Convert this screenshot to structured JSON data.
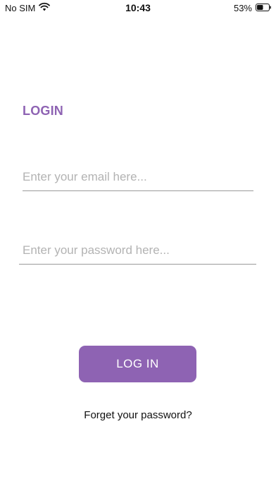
{
  "status_bar": {
    "carrier": "No SIM",
    "time": "10:43",
    "battery": "53%",
    "battery_level": 0.53,
    "wifi_icon": "wifi-icon",
    "battery_icon": "battery-icon"
  },
  "login": {
    "title": "LOGIN",
    "email_placeholder": "Enter your email here...",
    "email_value": "",
    "password_placeholder": "Enter your password here...",
    "password_value": "",
    "button_label": "LOG IN",
    "forgot_label": "Forget your password?"
  },
  "colors": {
    "accent": "#8e63b3",
    "underline": "#9a9a9a",
    "placeholder": "#b3b3b3"
  }
}
